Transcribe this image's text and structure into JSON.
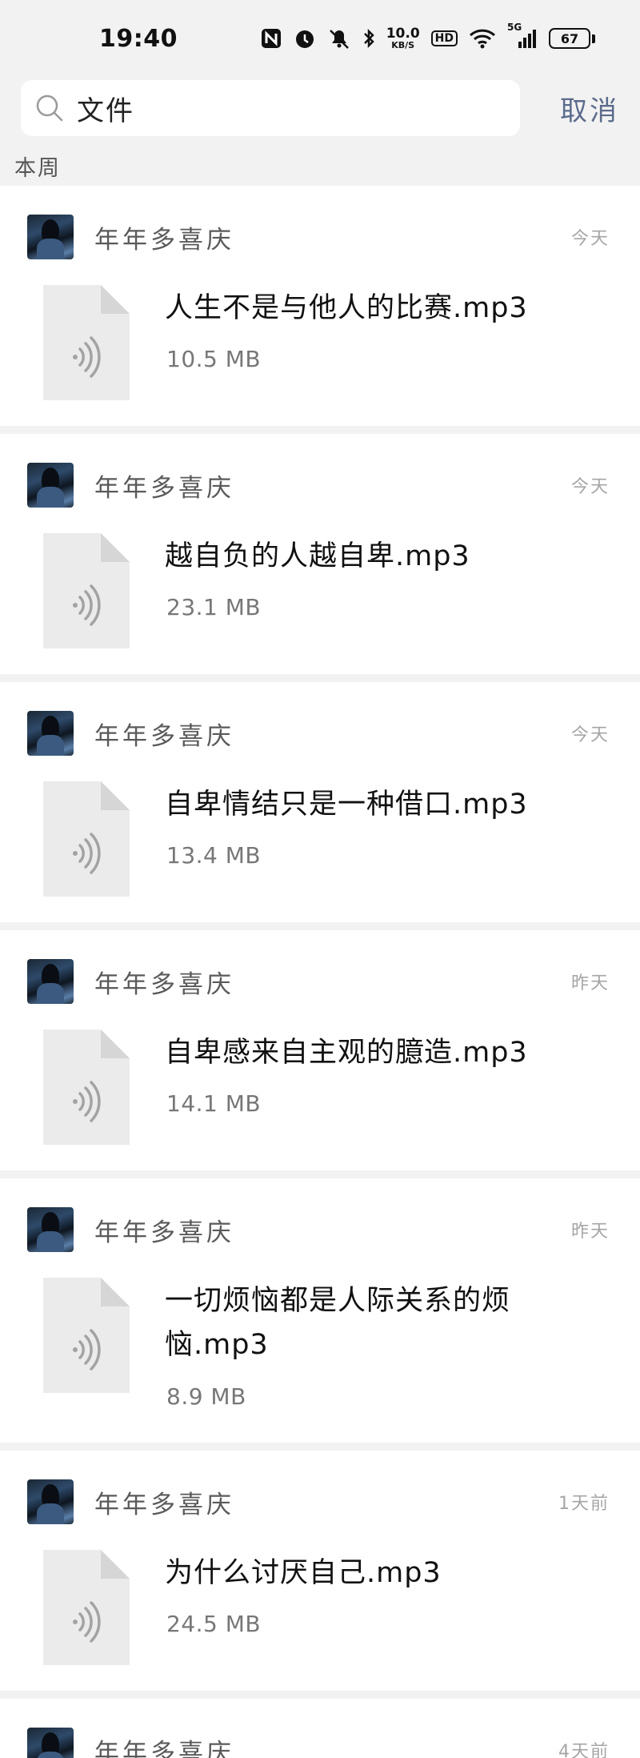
{
  "status_bar": {
    "time": "19:40",
    "net_speed_value": "10.0",
    "net_speed_unit": "KB/S",
    "hd": "HD",
    "signal": "5G",
    "battery": "67",
    "icons": [
      "nfc-icon",
      "alarm-icon",
      "mute-icon",
      "bluetooth-icon",
      "wifi-icon",
      "cell-signal-icon"
    ]
  },
  "search": {
    "query": "文件",
    "cancel_label": "取消"
  },
  "section_label": "本周",
  "items": [
    {
      "sender": "年年多喜庆",
      "time": "今天",
      "file_name": "人生不是与他人的比赛.mp3",
      "file_size": "10.5 MB"
    },
    {
      "sender": "年年多喜庆",
      "time": "今天",
      "file_name": "越自负的人越自卑.mp3",
      "file_size": "23.1 MB"
    },
    {
      "sender": "年年多喜庆",
      "time": "今天",
      "file_name": "自卑情结只是一种借口.mp3",
      "file_size": "13.4 MB"
    },
    {
      "sender": "年年多喜庆",
      "time": "昨天",
      "file_name": "自卑感来自主观的臆造.mp3",
      "file_size": "14.1 MB"
    },
    {
      "sender": "年年多喜庆",
      "time": "昨天",
      "file_name": "一切烦恼都是人际关系的烦恼.mp3",
      "file_size": "8.9 MB"
    },
    {
      "sender": "年年多喜庆",
      "time": "1天前",
      "file_name": "为什么讨厌自己.mp3",
      "file_size": "24.5 MB"
    },
    {
      "sender": "年年多喜庆",
      "time": "4天前"
    }
  ],
  "colors": {
    "background": "#f2f2f2",
    "card": "#ffffff",
    "accent": "#5b6b8c",
    "file_icon": "#ebebeb"
  }
}
